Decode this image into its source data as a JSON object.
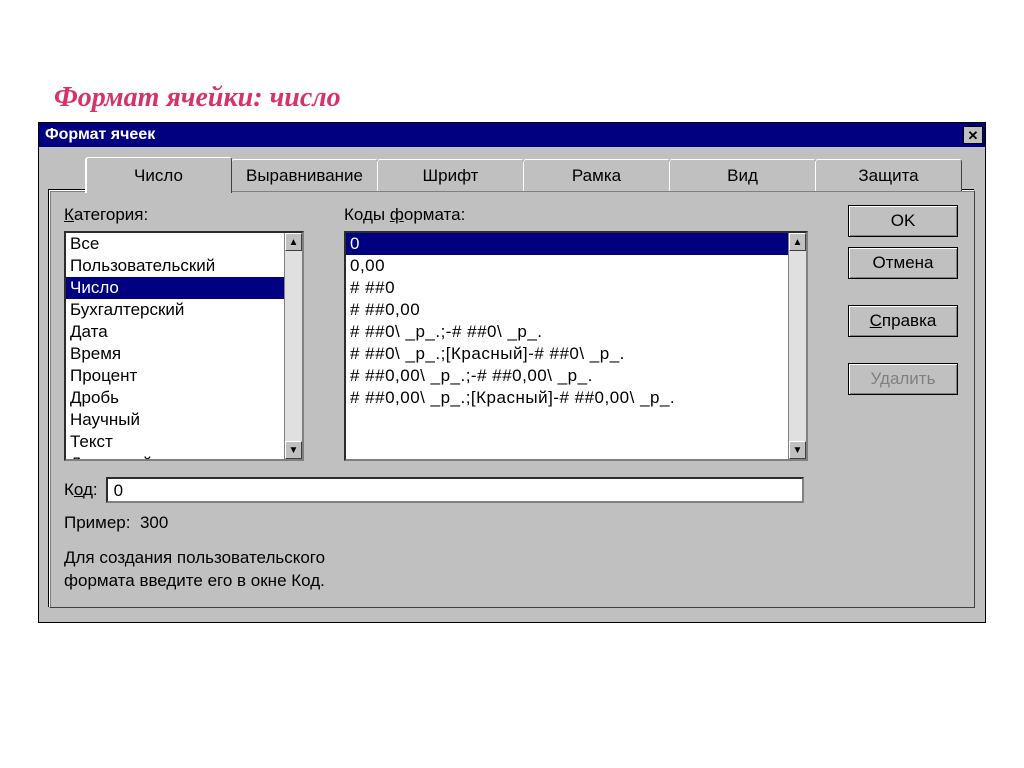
{
  "heading": "Формат ячейки:  число",
  "window": {
    "title": "Формат ячеек"
  },
  "tabs": {
    "items": [
      {
        "label": "Число"
      },
      {
        "label": "Выравнивание"
      },
      {
        "label": "Шрифт"
      },
      {
        "label": "Рамка"
      },
      {
        "label": "Вид"
      },
      {
        "label": "Защита"
      }
    ],
    "activeIndex": 0
  },
  "labels": {
    "category_pre": "К",
    "category_rest": "атегория:",
    "codes_pre": "Коды ",
    "codes_ul": "ф",
    "codes_rest": "ормата:",
    "code_pre": "К",
    "code_ul": "о",
    "code_rest": "д:",
    "sample_label": "Пример:",
    "sample_value": "300",
    "help_line1": "Для создания пользовательского",
    "help_line2": "формата введите его в окне Код."
  },
  "buttons": {
    "ok": "OK",
    "cancel": "Отмена",
    "help_ul": "С",
    "help_rest": "правка",
    "delete": "Удалить"
  },
  "categories": {
    "items": [
      "Все",
      "Пользовательский",
      "Число",
      "Бухгалтерский",
      "Дата",
      "Время",
      "Процент",
      "Дробь",
      "Научный",
      "Текст",
      "Денежный"
    ],
    "selectedIndex": 2
  },
  "codes": {
    "items": [
      "0",
      "0,00",
      "# ##0",
      "# ##0,00",
      "# ##0\\ _р_.;-# ##0\\ _р_.",
      "# ##0\\ _р_.;[Красный]-# ##0\\ _р_.",
      "# ##0,00\\ _р_.;-# ##0,00\\ _р_.",
      "# ##0,00\\ _р_.;[Красный]-# ##0,00\\ _р_."
    ],
    "selectedIndex": 0
  },
  "code_value": "0"
}
